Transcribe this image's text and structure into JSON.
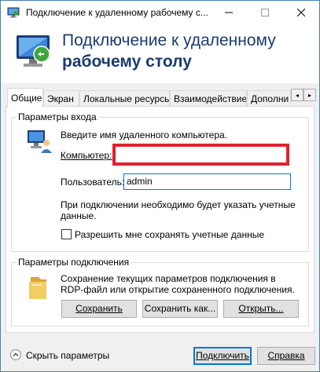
{
  "window": {
    "title": "Подключение к удаленному рабочему с...",
    "minimize_icon": "minimize-icon",
    "maximize_icon": "maximize-icon",
    "close_icon": "close-icon"
  },
  "banner": {
    "line1": "Подключение к удаленному",
    "line2": "рабочему столу",
    "icon": "remote-desktop-icon"
  },
  "tabs": [
    {
      "label": "Общие",
      "active": true
    },
    {
      "label": "Экран"
    },
    {
      "label": "Локальные ресурсы"
    },
    {
      "label": "Взаимодействие"
    },
    {
      "label": "Дополни"
    }
  ],
  "tab_scroll": {
    "left": "◂",
    "right": "▸"
  },
  "login_group": {
    "title": "Параметры входа",
    "prompt": "Введите имя удаленного компьютера.",
    "computer_label": "Компьютер:",
    "computer_value": "",
    "user_label": "Пользователь:",
    "user_value": "admin",
    "note_line1": "При подключении необходимо будет указать учетные",
    "note_line2": "данные.",
    "save_creds_label": "Разрешить мне сохранять учетные данные",
    "save_creds_checked": false
  },
  "conn_group": {
    "title": "Параметры подключения",
    "desc_line1": "Сохранение текущих параметров подключения в",
    "desc_line2": "RDP-файл или открытие сохраненного подключения.",
    "save_button": "Сохранить",
    "save_as_button": "Сохранить как...",
    "open_button": "Открыть..."
  },
  "footer": {
    "hide_options": "Скрыть параметры",
    "connect_button": "Подключить",
    "help_button": "Справка"
  },
  "colors": {
    "title_blue": "#1a3c6e",
    "highlight_red": "#e0222e",
    "focus_blue": "#0078d7"
  }
}
